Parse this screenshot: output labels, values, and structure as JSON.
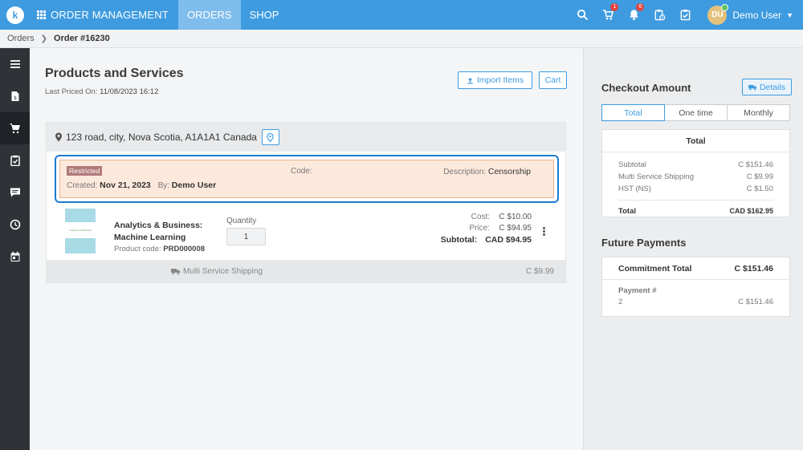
{
  "topbar": {
    "logo": "k",
    "app_title": "ORDER MANAGEMENT",
    "tabs": [
      {
        "label": "ORDERS",
        "active": true
      },
      {
        "label": "SHOP",
        "active": false
      }
    ],
    "cart_badge": "1",
    "bell_badge": "6",
    "avatar_initials": "DU",
    "username": "Demo User",
    "accent": "#3e9be0"
  },
  "breadcrumb": {
    "root": "Orders",
    "current": "Order #16230"
  },
  "sidebar": {
    "items": [
      {
        "icon": "menu-icon"
      },
      {
        "icon": "invoice-icon"
      },
      {
        "icon": "cart-icon",
        "active": true
      },
      {
        "icon": "clipboard-icon"
      },
      {
        "icon": "chat-icon"
      },
      {
        "icon": "history-icon"
      },
      {
        "icon": "calendar-icon"
      }
    ]
  },
  "main": {
    "title": "Products and Services",
    "last_priced_label": "Last Priced On:",
    "last_priced_value": "11/08/2023 16:12",
    "import_label": "Import Items",
    "cart_label": "Cart",
    "address": "123 road, city, Nova Scotia, A1A1A1 Canada",
    "restricted": {
      "badge": "Restricted",
      "created_label": "Created:",
      "created_value": "Nov 21, 2023",
      "by_label": "By:",
      "by_value": "Demo User",
      "code_label": "Code:",
      "desc_label": "Description:",
      "desc_value": "Censorship"
    },
    "item": {
      "thumb_text": "Analytics & Business",
      "name": "Analytics & Business: Machine Learning",
      "code_label": "Product code:",
      "code_value": "PRD000008",
      "qty_label": "Quantity",
      "qty_value": "1",
      "cost_label": "Cost:",
      "cost_value": "C $10.00",
      "price_label": "Price:",
      "price_value": "C $94.95",
      "subtotal_label": "Subtotal:",
      "subtotal_value": "CAD $94.95"
    },
    "shipping": {
      "label": "Multi Service Shipping",
      "value": "C $9.99"
    }
  },
  "checkout": {
    "title": "Checkout Amount",
    "details_label": "Details",
    "tabs": [
      "Total",
      "One time",
      "Monthly"
    ],
    "box_title": "Total",
    "lines": [
      {
        "label": "Subtotal",
        "value": "C $151.46"
      },
      {
        "label": "Multi Service Shipping",
        "value": "C $9.99"
      },
      {
        "label": "HST (NS)",
        "value": "C $1.50"
      }
    ],
    "total_label": "Total",
    "total_value": "CAD $162.95"
  },
  "future": {
    "title": "Future Payments",
    "commitment_label": "Commitment Total",
    "commitment_value": "C $151.46",
    "payment_header": "Payment #",
    "payment_num": "2",
    "payment_value": "C $151.46"
  }
}
